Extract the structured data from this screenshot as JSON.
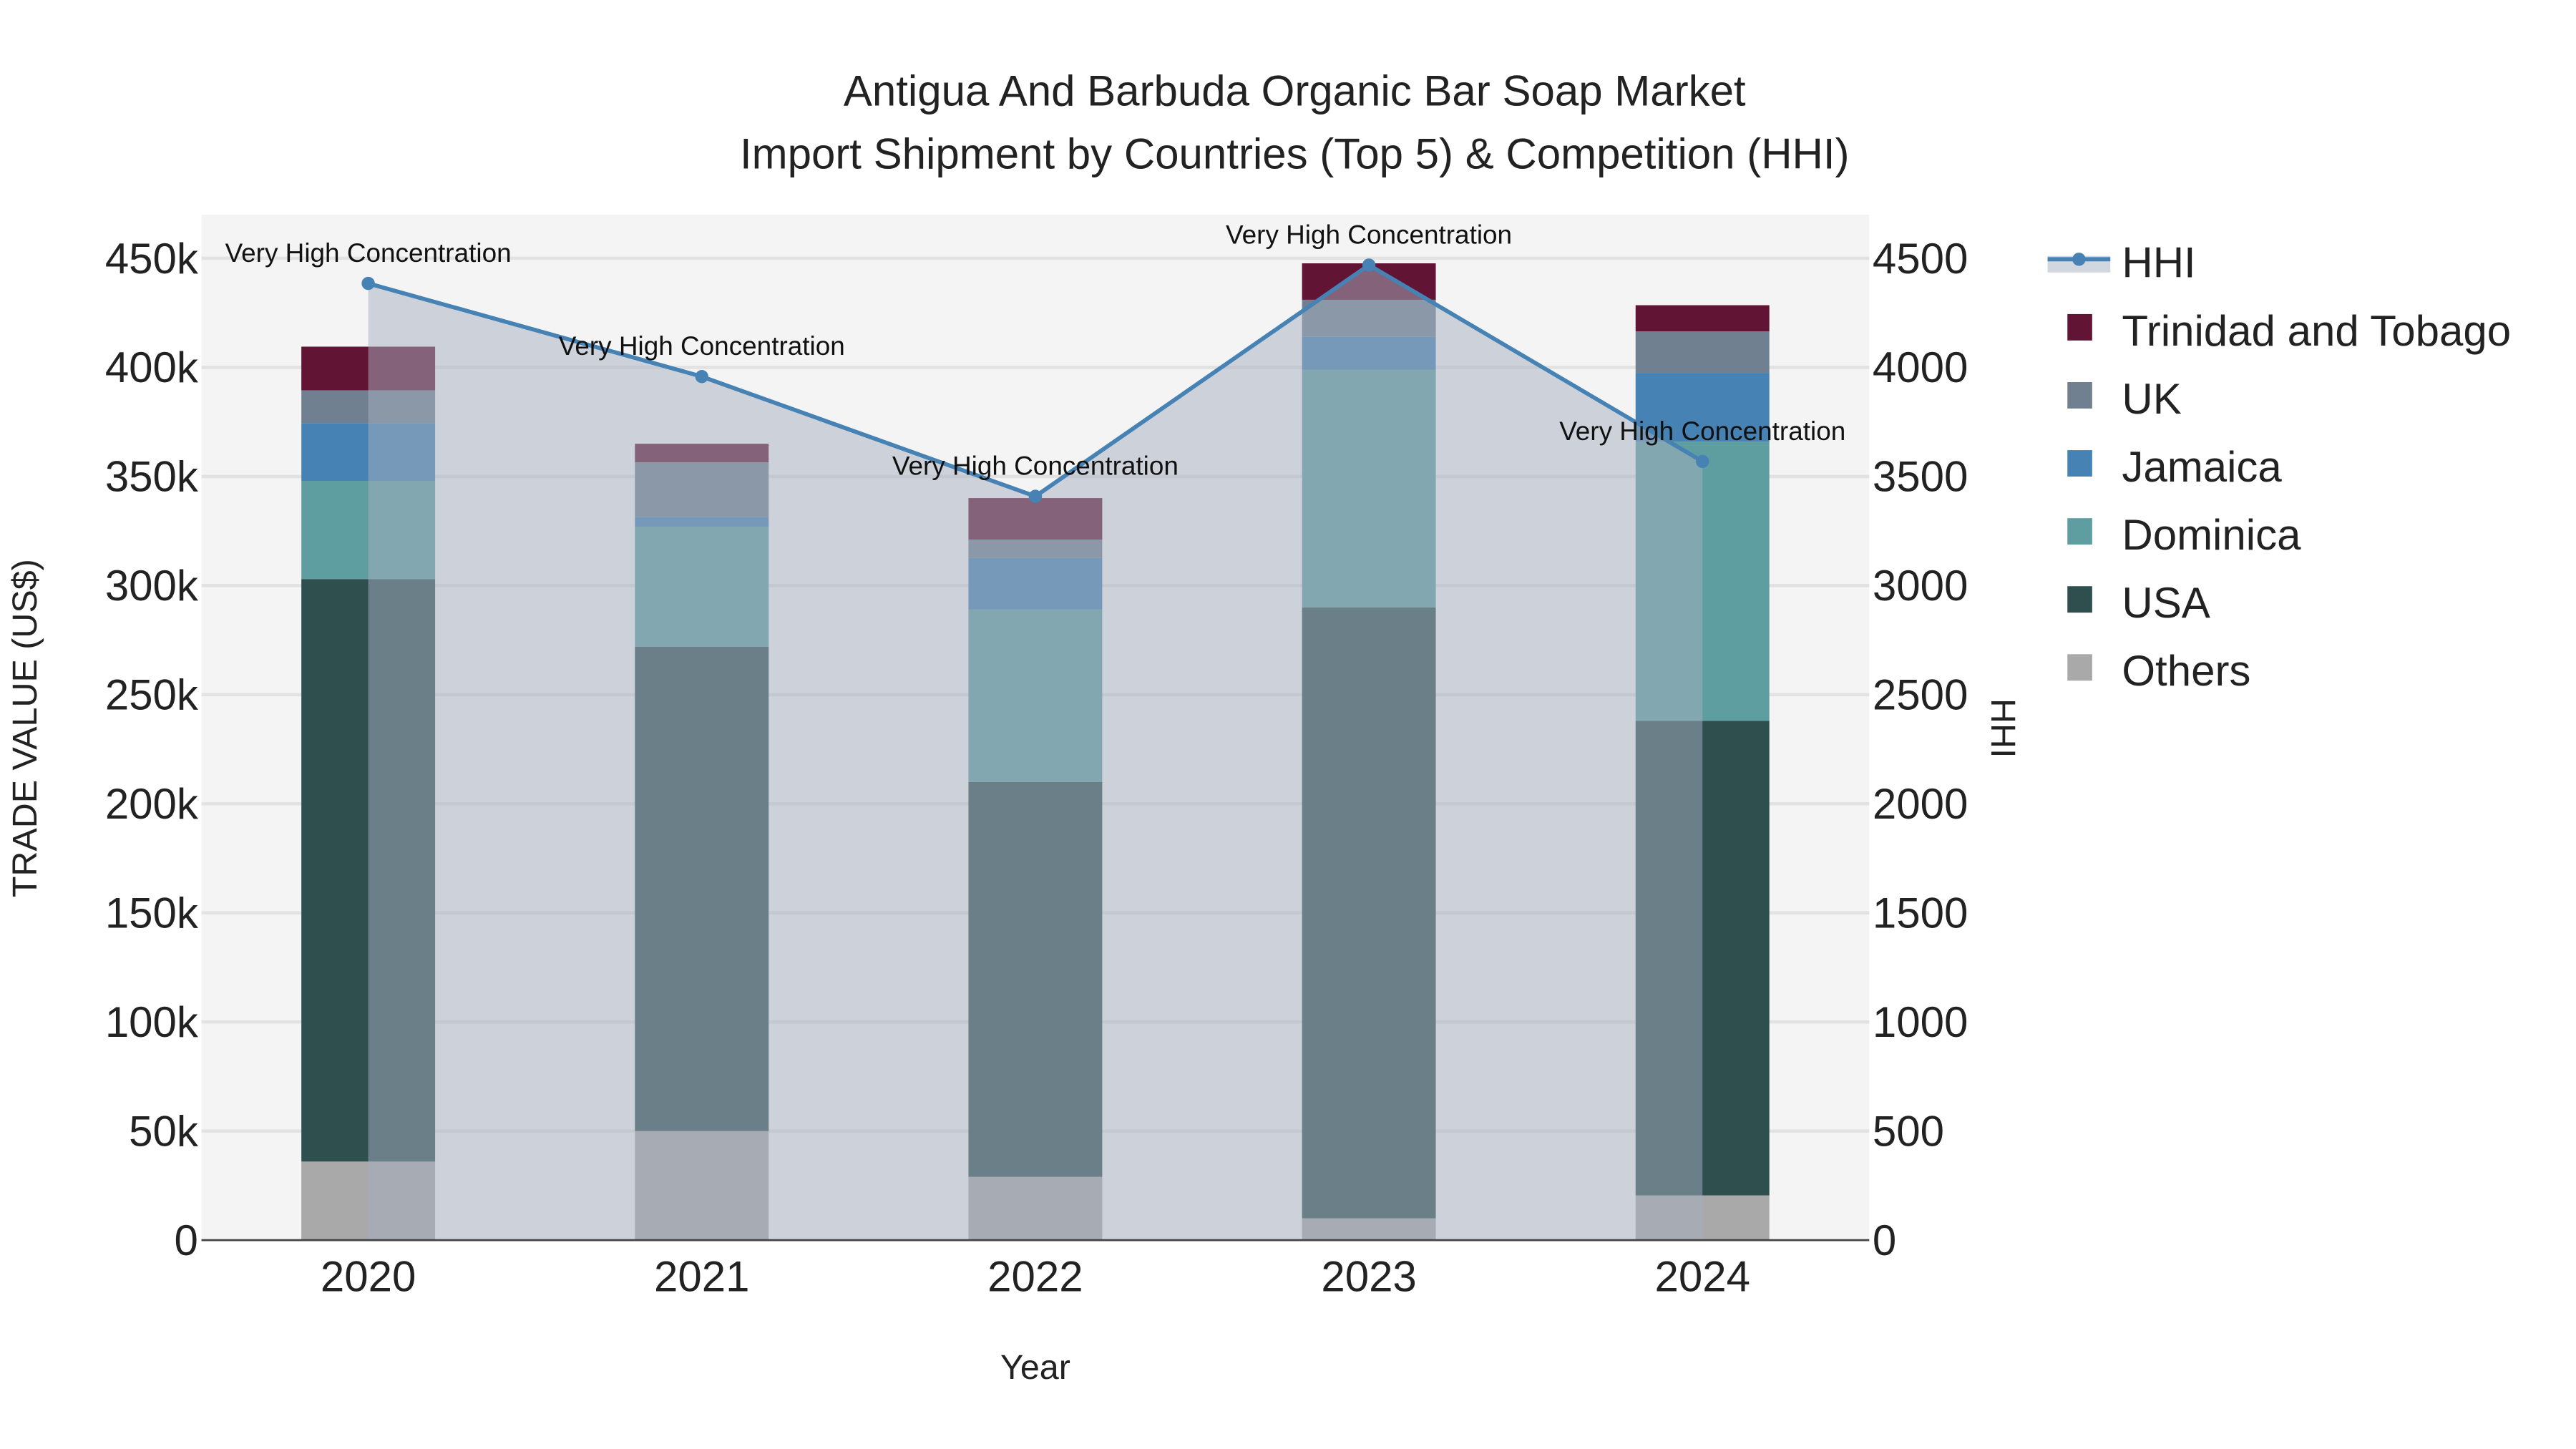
{
  "chart_data": {
    "type": "bar",
    "title_line1": "Antigua And Barbuda Organic Bar Soap Market",
    "title_line2": "Import Shipment by Countries (Top 5) & Competition (HHI)",
    "xlabel": "Year",
    "ylabel": "TRADE VALUE (US$)",
    "y2label": "HHI",
    "categories": [
      "2020",
      "2021",
      "2022",
      "2023",
      "2024"
    ],
    "ylim": [
      0,
      470000
    ],
    "y2lim": [
      0,
      4700
    ],
    "yticks": [
      "0",
      "50k",
      "100k",
      "150k",
      "200k",
      "250k",
      "300k",
      "350k",
      "400k",
      "450k"
    ],
    "ytick_values": [
      0,
      50000,
      100000,
      150000,
      200000,
      250000,
      300000,
      350000,
      400000,
      450000
    ],
    "y2ticks": [
      "0",
      "500",
      "1000",
      "1500",
      "2000",
      "2500",
      "3000",
      "3500",
      "4000",
      "4500"
    ],
    "y2tick_values": [
      0,
      500,
      1000,
      1500,
      2000,
      2500,
      3000,
      3500,
      4000,
      4500
    ],
    "stacked": true,
    "series": [
      {
        "name": "Others",
        "color": "#a9a9a9",
        "values": [
          36000,
          50000,
          29000,
          10000,
          20500
        ]
      },
      {
        "name": "USA",
        "color": "#2f4f4f",
        "values": [
          267000,
          222000,
          181000,
          280000,
          217500
        ]
      },
      {
        "name": "Dominica",
        "color": "#5f9ea0",
        "values": [
          45000,
          55000,
          79000,
          109000,
          128000
        ]
      },
      {
        "name": "Jamaica",
        "color": "#4682b4",
        "values": [
          26500,
          4500,
          23600,
          15000,
          31500
        ]
      },
      {
        "name": "UK",
        "color": "#708090",
        "values": [
          15000,
          25000,
          8500,
          17000,
          19000
        ]
      },
      {
        "name": "Trinidad and Tobago",
        "color": "#611434",
        "values": [
          20000,
          8500,
          19000,
          16700,
          12000
        ]
      }
    ],
    "hhi": {
      "name": "HHI",
      "color": "#4682b4",
      "values": [
        4385,
        3958,
        3409,
        4469,
        3569
      ]
    },
    "annotations": [
      "Very High Concentration",
      "Very High Concentration",
      "Very High Concentration",
      "Very High Concentration",
      "Very High Concentration"
    ],
    "legend": [
      "HHI",
      "Trinidad and Tobago",
      "UK",
      "Jamaica",
      "Dominica",
      "USA",
      "Others"
    ],
    "legend_position": "right",
    "grid": true
  }
}
